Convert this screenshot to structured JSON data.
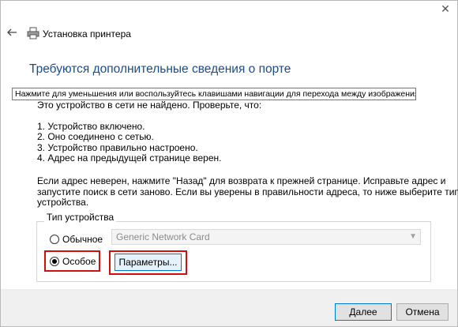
{
  "window": {
    "title": "Установка принтера",
    "close_glyph": "✕"
  },
  "heading": "Требуются дополнительные сведения о порте",
  "tooltip": "Нажмите для уменьшения или воспользуйтесь клавишами навигации для перехода между изображениями.",
  "intro": "Это устройство в сети не найдено. Проверьте, что:",
  "checklist": [
    "1.  Устройство включено.",
    "2.  Оно соединено с сетью.",
    "3.  Устройство правильно настроено.",
    "4.  Адрес на предыдущей странице верен."
  ],
  "explanation": [
    "Если адрес неверен, нажмите \"Назад\" для возврата к прежней странице.  Исправьте адрес и",
    "запустите поиск в сети заново.  Если вы уверены в правильности адреса, то ниже выберите тип",
    "устройства."
  ],
  "device_type": {
    "legend": "Тип устройства",
    "standard_label": "Обычное",
    "custom_label": "Особое",
    "selected": "custom",
    "combo_value": "Generic Network Card",
    "params_button": "Параметры..."
  },
  "footer": {
    "next_button": "Далее",
    "cancel_button": "Отмена"
  },
  "colors": {
    "heading": "#1c4b8c",
    "highlight": "#d01010",
    "focus": "#0078d7"
  },
  "icons": [
    "back-arrow-icon",
    "printer-icon",
    "close-icon",
    "chevron-down-icon"
  ]
}
